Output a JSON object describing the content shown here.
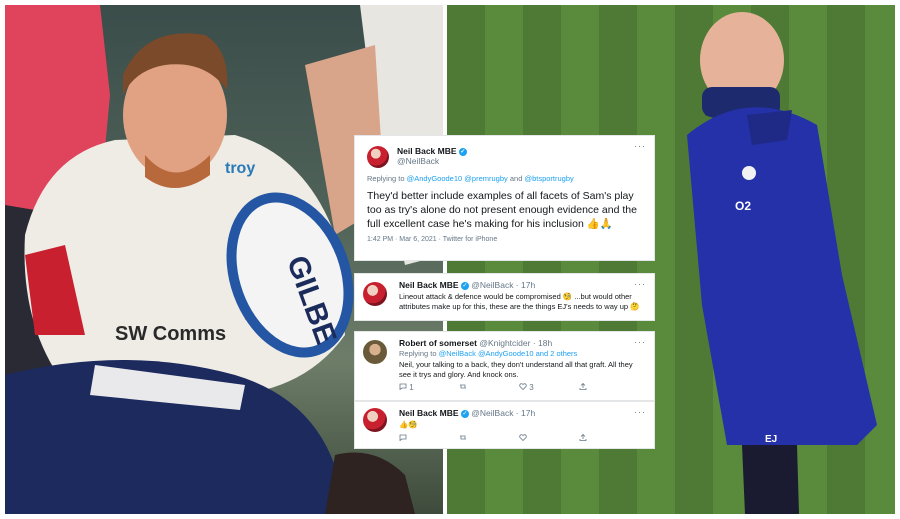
{
  "tweets": {
    "main": {
      "name": "Neil Back MBE",
      "handle": "@NeilBack",
      "replying_prefix": "Replying to",
      "reply_to_1": "@AndyGoode10",
      "reply_to_2": "@premrugby",
      "and": "and",
      "reply_to_3": "@btsportrugby",
      "text": "They'd better include examples of all facets of Sam's play too as try's alone do not present enough evidence and the full excellent case he's making for his inclusion 👍🙏",
      "meta": "1:42 PM · Mar 6, 2021 · Twitter for iPhone"
    },
    "reply1": {
      "name": "Neil Back MBE",
      "handle": "@NeilBack · 17h",
      "text": "Lineout attack & defence would be compromised 🧐 ...but would other attributes make up for this, these are the things EJ's needs to way up 🤔"
    },
    "reply2": {
      "name": "Robert of somerset",
      "handle": "@Knightcider · 18h",
      "replying_prefix": "Replying to",
      "reply_to_1": "@NeilBack",
      "reply_to_2": "@AndyGoode10",
      "and_others": "and 2 others",
      "text": "Neil, your talking to a back, they don't understand all that graft. All they see it trys and glory. And knock ons.",
      "reply_count": "1",
      "like_count": "3"
    },
    "reply3": {
      "name": "Neil Back MBE",
      "handle": "@NeilBack · 17h",
      "text": "👍🧐"
    }
  },
  "photos": {
    "left_sponsor_1": "SW Comms",
    "left_sponsor_2": "troy",
    "ball_text": "GILBE",
    "right_initials": "EJ",
    "right_logo": "O2"
  },
  "colors": {
    "verified": "#1da1f2",
    "link": "#1da1f2",
    "secondary_text": "#657786"
  }
}
